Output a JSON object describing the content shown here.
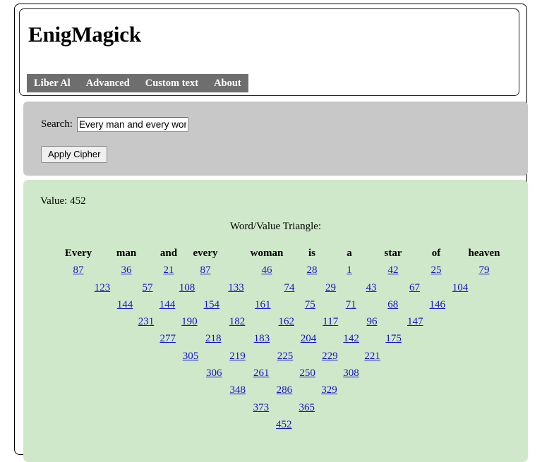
{
  "window": {
    "frame_border_color": "#000000"
  },
  "header": {
    "title": "EnigMagick",
    "nav": [
      {
        "label": "Liber Al"
      },
      {
        "label": "Advanced"
      },
      {
        "label": "Custom text"
      },
      {
        "label": "About"
      }
    ],
    "nav_background": "#6e6e6e",
    "nav_text_color": "#ffffff"
  },
  "search": {
    "label": "Search:",
    "value": "Every man and every wor",
    "placeholder": "",
    "apply_button_label": "Apply Cipher",
    "panel_background": "#c8c8c8"
  },
  "results": {
    "value_label": "Value: 452",
    "triangle_title": "Word/Value Triangle:",
    "panel_background": "#cfe8c9",
    "link_color": "#1414cc"
  },
  "chart_data": {
    "type": "table",
    "title": "Word/Value Triangle:",
    "total_value": 452,
    "words": [
      "Every",
      "man",
      "and",
      "every",
      "woman",
      "is",
      "a",
      "star",
      "of",
      "heaven"
    ],
    "rows": [
      [
        87,
        36,
        21,
        87,
        46,
        28,
        1,
        42,
        25,
        79
      ],
      [
        123,
        57,
        108,
        133,
        74,
        29,
        43,
        67,
        104
      ],
      [
        144,
        144,
        154,
        161,
        75,
        71,
        68,
        146
      ],
      [
        231,
        190,
        182,
        162,
        117,
        96,
        147
      ],
      [
        277,
        218,
        183,
        204,
        142,
        175
      ],
      [
        305,
        219,
        225,
        229,
        221
      ],
      [
        306,
        261,
        250,
        308
      ],
      [
        348,
        286,
        329
      ],
      [
        373,
        365
      ],
      [
        452
      ]
    ]
  }
}
